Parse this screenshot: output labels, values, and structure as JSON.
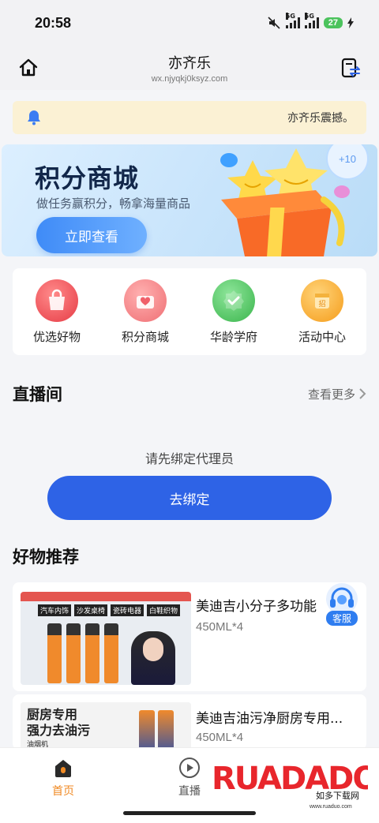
{
  "status": {
    "time": "20:58",
    "net1": "5G",
    "net2": "5G",
    "battery": "27"
  },
  "header": {
    "title": "亦齐乐",
    "url": "wx.njyqkj0ksyz.com"
  },
  "notice": {
    "text": "亦齐乐震撼。"
  },
  "banner": {
    "title": "积分商城",
    "subtitle": "做任务赢积分，畅拿海量商品",
    "button": "立即查看",
    "badge": "+10"
  },
  "quick_menu": [
    {
      "label": "优选好物",
      "icon": "shopping-bag-icon",
      "color": "#f2595a"
    },
    {
      "label": "积分商城",
      "icon": "heart-gift-icon",
      "color": "#f47a7a"
    },
    {
      "label": "华龄学府",
      "icon": "check-badge-icon",
      "color": "#4cc95e"
    },
    {
      "label": "活动中心",
      "icon": "calendar-tag-icon",
      "color": "#f6a623"
    }
  ],
  "live": {
    "title": "直播间",
    "more": "查看更多",
    "hint": "请先绑定代理员",
    "button": "去绑定"
  },
  "recommend": {
    "title": "好物推荐",
    "products": [
      {
        "name": "美迪吉小分子多功能",
        "spec": "450ML*4",
        "img_tags": [
          "汽车内饰",
          "沙发桌椅",
          "瓷砖电器",
          "白鞋织物"
        ]
      },
      {
        "name": "美迪吉油污净厨房专用...",
        "spec": "450ML*4",
        "img_text1": "厨房专用",
        "img_text2": "强力去油污",
        "img_tag": "油烟机"
      }
    ]
  },
  "service": {
    "label": "客服"
  },
  "tabs": [
    {
      "label": "首页",
      "icon": "home-tab-icon",
      "active": true
    },
    {
      "label": "直播",
      "icon": "play-circle-icon",
      "active": false
    }
  ],
  "watermark": {
    "brand": "RUADADO",
    "cn": "如多下载网",
    "site": "www.ruaduo.com"
  },
  "colors": {
    "primary": "#2e63e6",
    "active_tab": "#f08a24",
    "notice_bg": "#fbf1d4"
  }
}
